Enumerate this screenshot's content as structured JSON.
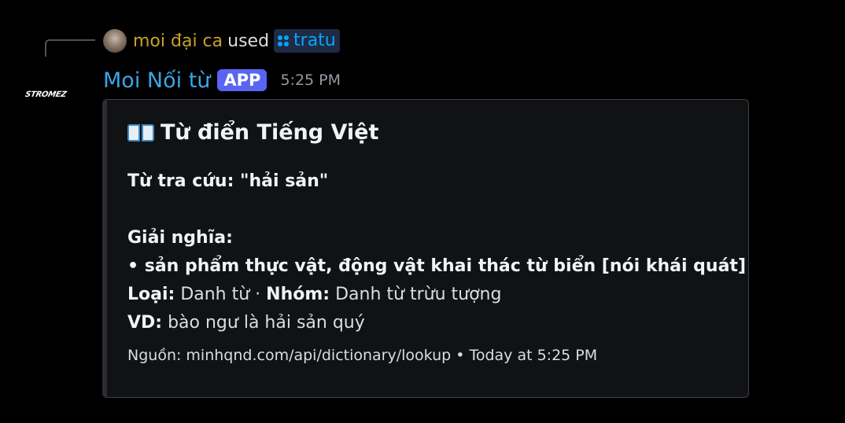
{
  "reply": {
    "username": "moi đại ca",
    "action": "used",
    "command": "tratu"
  },
  "message": {
    "author": "Moi Nối từ",
    "badge": "APP",
    "timestamp": "5:25 PM",
    "avatar_text": "STROMEZ"
  },
  "embed": {
    "title": "Từ điển Tiếng Việt",
    "lookup_label": "Từ tra cứu: \"hải sản\"",
    "meaning_label": "Giải nghĩa:",
    "meaning": "• sản phẩm thực vật, động vật khai thác từ biển [nói khái quát]",
    "type_label": "Loại:",
    "type_value": " Danh từ · ",
    "group_label": "Nhóm:",
    "group_value": " Danh từ trừu tượng",
    "example_label": "VD:",
    "example_value": " bào ngư là hải sản quý",
    "footer": "Nguồn: minhqnd.com/api/dictionary/lookup • Today at 5:25 PM"
  },
  "colors": {
    "background": "#000000",
    "author": "#3ba5e6",
    "reply_user": "#c9a227",
    "badge": "#5865f2",
    "command": "#00a8fc",
    "embed_bg": "#111214"
  }
}
